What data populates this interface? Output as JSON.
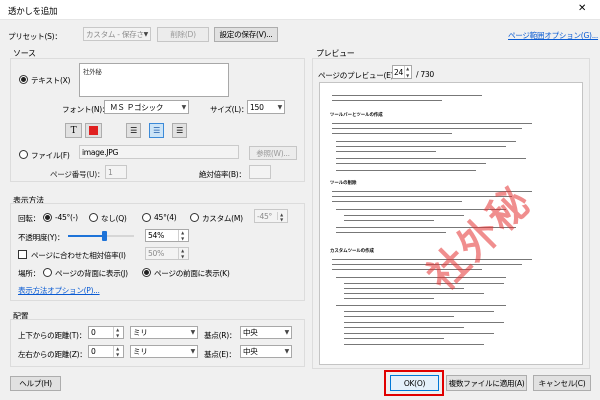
{
  "title": "透かしを追加",
  "close_glyph": "✕",
  "preset": {
    "label": "プリセット(S)：",
    "value": "カスタム - 保存されていま",
    "delete": "削除(D)",
    "save": "設定の保存(V)...",
    "range_link": "ページ範囲オプション(G)..."
  },
  "source": {
    "title": "ソース",
    "text_label": "テキスト(X)",
    "text_value": "社外秘",
    "font_label": "フォント(N)：",
    "font_value": "ＭＳ Ｐゴシック",
    "size_label": "サイズ(L)：",
    "size_value": "150",
    "text_color": "#e02020",
    "file_label": "ファイル(F)",
    "file_value": "image.JPG",
    "browse": "参照(W)...",
    "page_label": "ページ番号(U)：",
    "page_value": "1",
    "scale_label": "絶対倍率(B)：",
    "scale_value": ""
  },
  "appearance": {
    "title": "表示方法",
    "rotation_label": "回転：",
    "rot_m45": "-45°(-)",
    "rot_none": "なし(Q)",
    "rot_45": "45°(4)",
    "rot_custom": "カスタム(M)",
    "rot_custom_value": "-45°",
    "opacity_label": "不透明度(Y)：",
    "opacity_value": "54%",
    "opacity_level": 0.54,
    "relative_label": "ページに合わせた相対倍率(I)",
    "relative_value": "50%",
    "location_label": "場所：",
    "behind": "ページの背面に表示(J)",
    "front": "ページの前面に表示(K)",
    "options_link": "表示方法オプション(P)..."
  },
  "placement": {
    "title": "配置",
    "vertical_label": "上下からの距離(T)：",
    "vertical_value": "0",
    "vertical_unit": "ミリ",
    "vertical_base_label": "基点(R)：",
    "vertical_base": "中央",
    "horizontal_label": "左右からの距離(Z)：",
    "horizontal_value": "0",
    "horizontal_unit": "ミリ",
    "horizontal_base_label": "基点(E)：",
    "horizontal_base": "中央"
  },
  "preview": {
    "title": "プレビュー",
    "page_label": "ページのプレビュー(E)",
    "page_value": "24",
    "total": "/ 730",
    "headings": [
      "ツールバーとツールの作成",
      "ツールの削除",
      "カスタムツールの作成"
    ],
    "watermark": "社外秘"
  },
  "buttons": {
    "help": "ヘルプ(H)",
    "ok": "OK(O)",
    "apply_multiple": "複数ファイルに適用(A)",
    "cancel": "キャンセル(C)"
  },
  "colors": {
    "highlight": "#e00000",
    "link": "#0a5bd3",
    "slider": "#1e73d8"
  }
}
